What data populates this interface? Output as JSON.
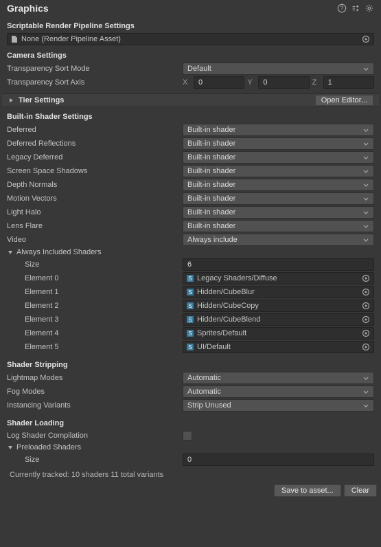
{
  "header": {
    "title": "Graphics"
  },
  "srp": {
    "section_title": "Scriptable Render Pipeline Settings",
    "asset_label": "None (Render Pipeline Asset)"
  },
  "camera": {
    "section_title": "Camera Settings",
    "transp_sort_mode_label": "Transparency Sort Mode",
    "transp_sort_mode_value": "Default",
    "transp_sort_axis_label": "Transparency Sort Axis",
    "axis_x": "0",
    "axis_y": "0",
    "axis_z": "1"
  },
  "tier": {
    "label": "Tier Settings",
    "open_editor_label": "Open Editor..."
  },
  "builtin": {
    "section_title": "Built-in Shader Settings",
    "rows": [
      {
        "label": "Deferred",
        "value": "Built-in shader"
      },
      {
        "label": "Deferred Reflections",
        "value": "Built-in shader"
      },
      {
        "label": "Legacy Deferred",
        "value": "Built-in shader"
      },
      {
        "label": "Screen Space Shadows",
        "value": "Built-in shader"
      },
      {
        "label": "Depth Normals",
        "value": "Built-in shader"
      },
      {
        "label": "Motion Vectors",
        "value": "Built-in shader"
      },
      {
        "label": "Light Halo",
        "value": "Built-in shader"
      },
      {
        "label": "Lens Flare",
        "value": "Built-in shader"
      }
    ],
    "video_label": "Video",
    "video_value": "Always include"
  },
  "always_included": {
    "foldout_label": "Always Included Shaders",
    "size_label": "Size",
    "size_value": "6",
    "elements": [
      {
        "label": "Element 0",
        "value": "Legacy Shaders/Diffuse"
      },
      {
        "label": "Element 1",
        "value": "Hidden/CubeBlur"
      },
      {
        "label": "Element 2",
        "value": "Hidden/CubeCopy"
      },
      {
        "label": "Element 3",
        "value": "Hidden/CubeBlend"
      },
      {
        "label": "Element 4",
        "value": "Sprites/Default"
      },
      {
        "label": "Element 5",
        "value": "UI/Default"
      }
    ]
  },
  "stripping": {
    "section_title": "Shader Stripping",
    "lightmap_label": "Lightmap Modes",
    "lightmap_value": "Automatic",
    "fog_label": "Fog Modes",
    "fog_value": "Automatic",
    "instancing_label": "Instancing Variants",
    "instancing_value": "Strip Unused"
  },
  "loading": {
    "section_title": "Shader Loading",
    "log_label": "Log Shader Compilation",
    "preloaded_foldout": "Preloaded Shaders",
    "size_label": "Size",
    "size_value": "0"
  },
  "tracked": "Currently tracked: 10 shaders 11 total variants",
  "footer": {
    "save_label": "Save to asset...",
    "clear_label": "Clear"
  }
}
